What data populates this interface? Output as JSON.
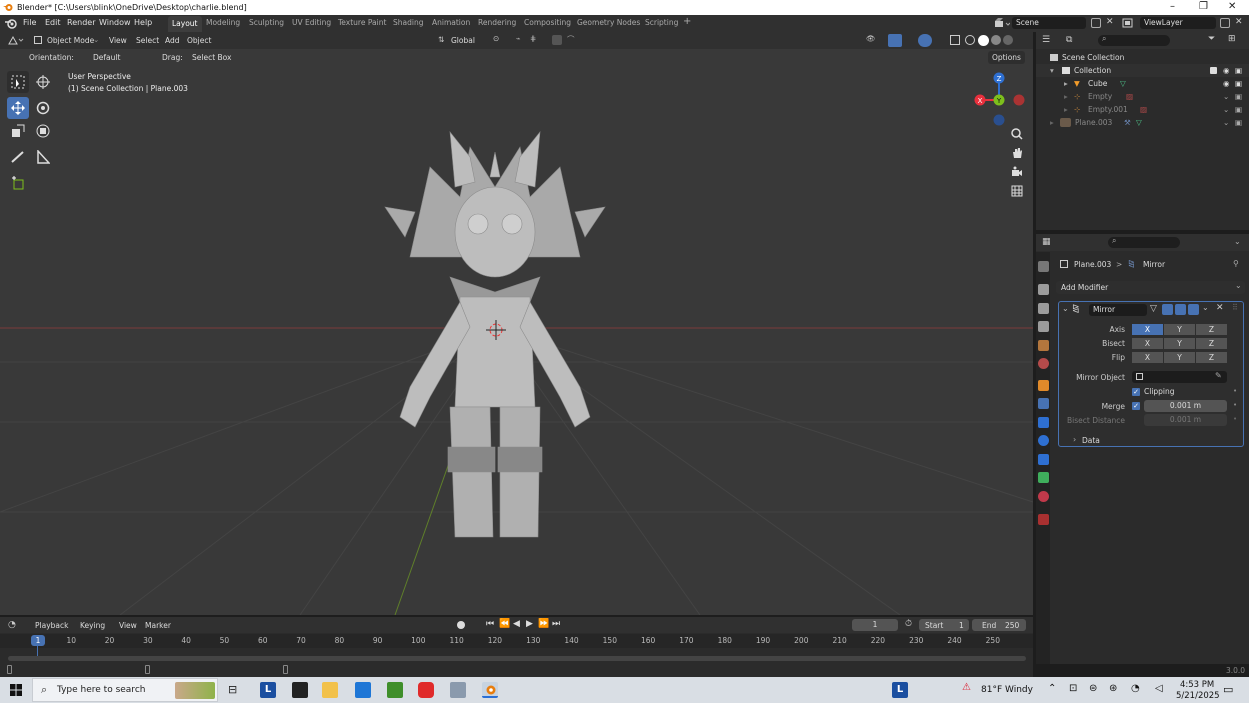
{
  "window": {
    "title": "Blender* [C:\\Users\\blink\\OneDrive\\Desktop\\charlie.blend]",
    "minimize": "–",
    "maximize": "❐",
    "close": "✕"
  },
  "menubar": {
    "items": [
      "File",
      "Edit",
      "Render",
      "Window",
      "Help"
    ]
  },
  "workspaces": {
    "tabs": [
      "Layout",
      "Modeling",
      "Sculpting",
      "UV Editing",
      "Texture Paint",
      "Shading",
      "Animation",
      "Rendering",
      "Compositing",
      "Geometry Nodes",
      "Scripting"
    ],
    "active": "Layout",
    "add": "+"
  },
  "scene": {
    "name": "Scene",
    "view_layer": "ViewLayer"
  },
  "viewport": {
    "mode": "Object Mode",
    "menus": [
      "View",
      "Select",
      "Add",
      "Object"
    ],
    "transform": "Global",
    "orientation_label": "Orientation:",
    "orientation_value": "Default",
    "drag_label": "Drag:",
    "drag_value": "Select Box",
    "options": "Options",
    "info_line1": "User Perspective",
    "info_line2": "(1) Scene Collection | Plane.003",
    "gizmo": {
      "x": "X",
      "y": "Y",
      "z": "Z"
    }
  },
  "outliner": {
    "root": "Scene Collection",
    "items": [
      {
        "label": "Collection"
      },
      {
        "label": "Cube"
      },
      {
        "label": "Empty"
      },
      {
        "label": "Empty.001"
      },
      {
        "label": "Plane.003"
      }
    ]
  },
  "properties": {
    "breadcrumb_object": "Plane.003",
    "breadcrumb_sep": ">",
    "breadcrumb_modifier": "Mirror",
    "add_modifier": "Add Modifier",
    "modifier_name": "Mirror",
    "axis_label": "Axis",
    "bisect_label": "Bisect",
    "flip_label": "Flip",
    "axes": [
      "X",
      "Y",
      "Z"
    ],
    "mirror_object_label": "Mirror Object",
    "clipping_label": "Clipping",
    "merge_label": "Merge",
    "merge_value": "0.001 m",
    "bisect_distance_label": "Bisect Distance",
    "bisect_distance_value": "0.001 m",
    "data_label": "Data",
    "clipping_checked": true,
    "merge_checked": true
  },
  "timeline": {
    "menus": [
      "Playback",
      "Keying",
      "View",
      "Marker"
    ],
    "current_frame": "1",
    "start_label": "Start",
    "start": "1",
    "end_label": "End",
    "end": "250",
    "ticks": [
      "1",
      "10",
      "20",
      "30",
      "40",
      "50",
      "60",
      "70",
      "80",
      "90",
      "100",
      "110",
      "120",
      "130",
      "140",
      "150",
      "160",
      "170",
      "180",
      "190",
      "200",
      "210",
      "220",
      "230",
      "240",
      "250"
    ],
    "marker_frame": "1"
  },
  "statusbar": {
    "version": "3.0.0"
  },
  "taskbar": {
    "search_placeholder": "Type here to search",
    "weather": "81°F  Windy",
    "time": "4:53 PM",
    "date": "5/21/2025"
  },
  "colors": {
    "accent": "#4772b3",
    "x_axis": "#e8303d",
    "y_axis": "#7dbf1c",
    "z_axis": "#2e6fd1",
    "viewport_bg": "#393939"
  }
}
